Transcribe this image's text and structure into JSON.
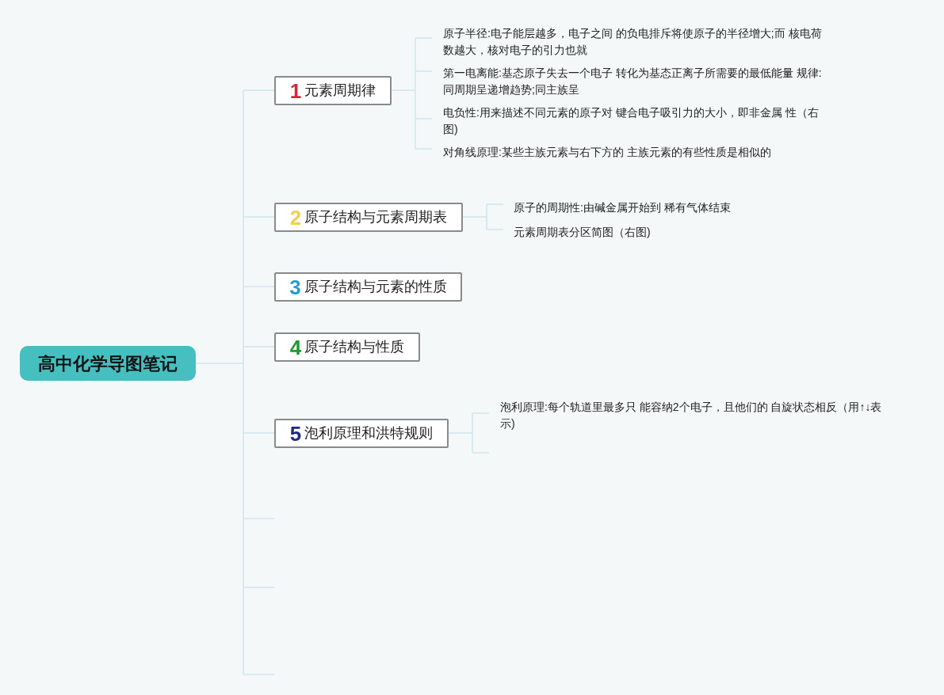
{
  "root": {
    "title": "高中化学导图笔记"
  },
  "topics": [
    {
      "number": "1",
      "color": "#d9263a",
      "label": "元素周期律",
      "children": [
        "原子半径:电子能层越多，电子之间 的负电排斥将使原子的半径增大;而 核电荷数越大，核对电子的引力也就",
        "第一电离能:基态原子失去一个电子 转化为基态正离子所需要的最低能量 规律:同周期呈递增趋势;同主族呈",
        "电负性:用来描述不同元素的原子对 键合电子吸引力的大小，即非金属 性（右图)",
        "对角线原理:某些主族元素与右下方的 主族元素的有些性质是相似的"
      ]
    },
    {
      "number": "2",
      "color": "#f2cf4c",
      "label": "原子结构与元素周期表",
      "children": [
        "原子的周期性:由碱金属开始到 稀有气体结束",
        "元素周期表分区简图（右图)"
      ]
    },
    {
      "number": "3",
      "color": "#2b9ad6",
      "label": "原子结构与元素的性质"
    },
    {
      "number": "4",
      "color": "#1d9a2c",
      "label": "原子结构与性质"
    },
    {
      "number": "5",
      "color": "#1f2a80",
      "label": "泡利原理和洪特规则",
      "children": [
        "泡利原理:每个轨道里最多只 能容纳2个电子，且他们的 自旋状态相反（用↑↓表示)"
      ]
    }
  ]
}
